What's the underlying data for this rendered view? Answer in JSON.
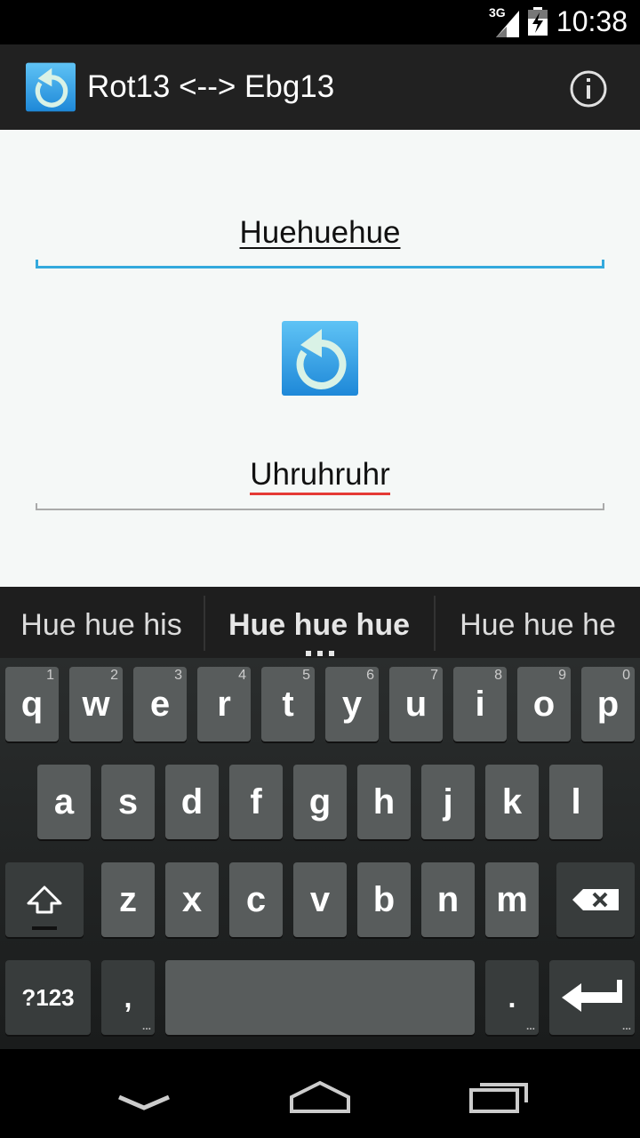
{
  "status_bar": {
    "network": "3G",
    "time": "10:38"
  },
  "action_bar": {
    "title": "Rot13 <--> Ebg13",
    "info_icon": "info-icon",
    "app_icon": "rotate-ccw-icon"
  },
  "main": {
    "input_value": "Huehuehue",
    "output_value": "Uhruhruhr",
    "convert_icon": "rotate-ccw-icon"
  },
  "suggestions": [
    "Hue hue his",
    "Hue hue hue",
    "Hue hue he"
  ],
  "keyboard": {
    "row1": [
      {
        "l": "q",
        "h": "1"
      },
      {
        "l": "w",
        "h": "2"
      },
      {
        "l": "e",
        "h": "3"
      },
      {
        "l": "r",
        "h": "4"
      },
      {
        "l": "t",
        "h": "5"
      },
      {
        "l": "y",
        "h": "6"
      },
      {
        "l": "u",
        "h": "7"
      },
      {
        "l": "i",
        "h": "8"
      },
      {
        "l": "o",
        "h": "9"
      },
      {
        "l": "p",
        "h": "0"
      }
    ],
    "row2": [
      "a",
      "s",
      "d",
      "f",
      "g",
      "h",
      "j",
      "k",
      "l"
    ],
    "row3": [
      "z",
      "x",
      "c",
      "v",
      "b",
      "n",
      "m"
    ],
    "symbols_label": "?123",
    "comma_label": ",",
    "period_label": ".",
    "more_indicator": "..."
  },
  "colors": {
    "accent": "#33a9dd",
    "spell_error": "#e53935",
    "action_bar": "#212121"
  }
}
